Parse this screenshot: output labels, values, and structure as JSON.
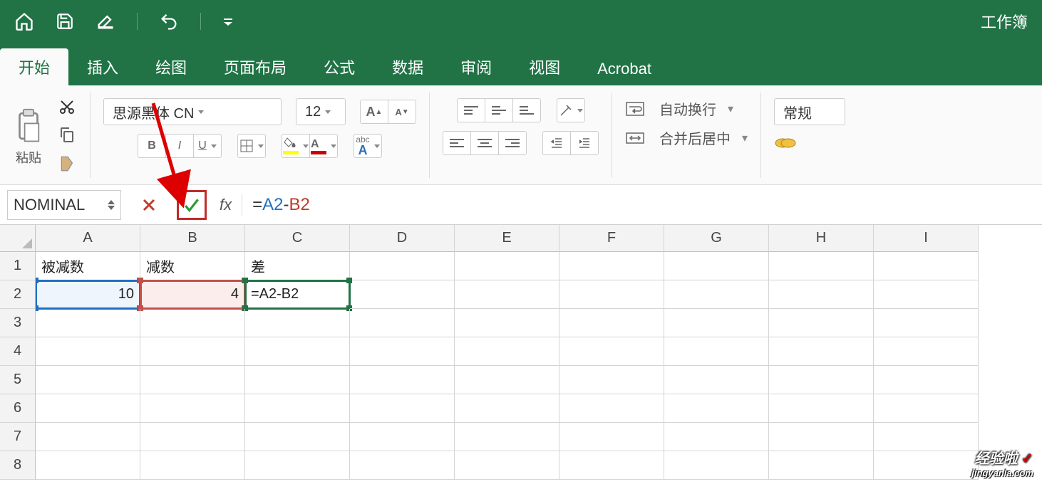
{
  "titlebar": {
    "workbook_name": "工作簿"
  },
  "tabs": [
    "开始",
    "插入",
    "绘图",
    "页面布局",
    "公式",
    "数据",
    "审阅",
    "视图",
    "Acrobat"
  ],
  "ribbon": {
    "paste_label": "粘贴",
    "font_name": "思源黑体 CN",
    "font_size": "12",
    "bold": "B",
    "italic": "I",
    "underline": "U",
    "wrap_label": "自动换行",
    "merge_label": "合并后居中",
    "number_format": "常规"
  },
  "formula_bar": {
    "name_box": "NOMINAL",
    "fx": "fx",
    "prefix": "=",
    "ref_a": "A2",
    "op": "-",
    "ref_b": "B2"
  },
  "grid": {
    "cols": [
      "A",
      "B",
      "C",
      "D",
      "E",
      "F",
      "G",
      "H",
      "I"
    ],
    "rows": [
      "1",
      "2",
      "3",
      "4",
      "5",
      "6",
      "7",
      "8"
    ],
    "header_row": {
      "A": "被减数",
      "B": "减数",
      "C": "差"
    },
    "data_row": {
      "A": "10",
      "B": "4",
      "C": "=A2-B2"
    }
  },
  "watermark": {
    "main": "经验啦",
    "check": "✓",
    "sub": "jingyanla.com"
  }
}
